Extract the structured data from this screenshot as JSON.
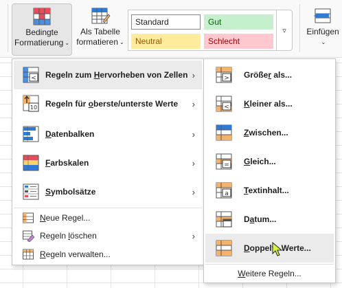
{
  "ribbon": {
    "conditional_formatting": {
      "line1": "Bedingte",
      "line2": "Formatierung"
    },
    "format_as_table": {
      "line1": "Als Tabelle",
      "line2": "formatieren"
    },
    "styles": [
      {
        "label": "Standard",
        "bg": "#ffffff",
        "color": "#1f1f1f"
      },
      {
        "label": "Gut",
        "bg": "#c6efce",
        "color": "#006100"
      },
      {
        "label": "Neutral",
        "bg": "#ffeb9c",
        "color": "#9c5700"
      },
      {
        "label": "Schlecht",
        "bg": "#ffc7ce",
        "color": "#9c0006"
      }
    ],
    "insert": {
      "label": "Einfügen"
    }
  },
  "main_menu": {
    "items": [
      {
        "pre": "Regeln zum ",
        "key": "H",
        "post": "ervorheben von Zellen",
        "icon": "highlight-cells-rules-icon"
      },
      {
        "pre": "Regeln für ",
        "key": "o",
        "post": "berste/unterste Werte",
        "icon": "top-bottom-rules-icon"
      },
      {
        "pre": "",
        "key": "D",
        "post": "atenbalken",
        "icon": "data-bars-icon"
      },
      {
        "pre": "",
        "key": "F",
        "post": "arbskalen",
        "icon": "color-scales-icon"
      },
      {
        "pre": "",
        "key": "S",
        "post": "ymbolsätze",
        "icon": "icon-sets-icon"
      },
      {
        "pre": "",
        "key": "N",
        "post": "eue Regel...",
        "icon": "new-rule-icon"
      },
      {
        "pre": "Regeln ",
        "key": "l",
        "post": "öschen",
        "icon": "clear-rules-icon"
      },
      {
        "pre": "",
        "key": "R",
        "post": "egeln verwalten...",
        "icon": "manage-rules-icon"
      }
    ]
  },
  "sub_menu": {
    "items": [
      {
        "pre": "Größe",
        "key": "r",
        "post": " als...",
        "icon": "greater-than-icon"
      },
      {
        "pre": "",
        "key": "K",
        "post": "leiner als...",
        "icon": "less-than-icon"
      },
      {
        "pre": "",
        "key": "Z",
        "post": "wischen...",
        "icon": "between-icon"
      },
      {
        "pre": "",
        "key": "G",
        "post": "leich...",
        "icon": "equal-to-icon"
      },
      {
        "pre": "",
        "key": "T",
        "post": "extinhalt...",
        "icon": "text-contains-icon"
      },
      {
        "pre": "D",
        "key": "a",
        "post": "tum...",
        "icon": "date-occurring-icon"
      },
      {
        "pre": "",
        "key": "D",
        "post": "oppelte Werte...",
        "icon": "duplicate-values-icon"
      }
    ],
    "more": {
      "pre": "",
      "key": "W",
      "post": "eitere Regeln..."
    }
  },
  "colors": {
    "accent_blue": "#2e7bd6",
    "highlight_orange": "#f6b26b",
    "highlight_red": "#e84b5a",
    "menu_hover": "#ebebeb"
  }
}
